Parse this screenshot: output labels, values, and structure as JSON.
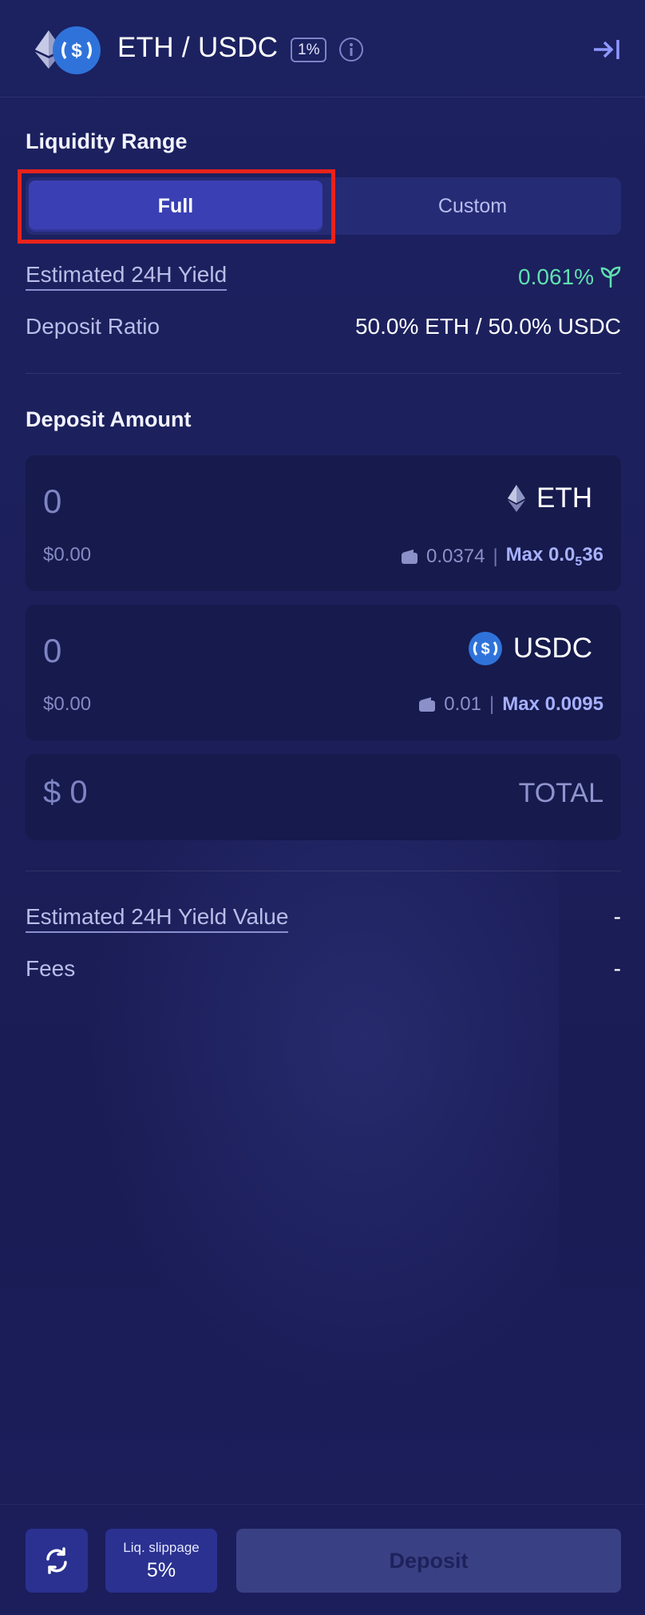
{
  "header": {
    "pair": "ETH / USDC",
    "fee_tier": "1%",
    "icons": [
      "eth-icon",
      "usdc-icon",
      "info-icon",
      "collapse-panel-icon"
    ]
  },
  "liquidity_range": {
    "title": "Liquidity Range",
    "options": [
      "Full",
      "Custom"
    ],
    "selected": "Full"
  },
  "stats": {
    "yield_label": "Estimated 24H Yield",
    "yield_value": "0.061%",
    "ratio_label": "Deposit Ratio",
    "ratio_value": "50.0% ETH / 50.0% USDC"
  },
  "deposit": {
    "title": "Deposit Amount",
    "eth": {
      "amount": "0",
      "symbol": "ETH",
      "usd": "$0.00",
      "balance": "0.0374",
      "max_prefix": "Max 0.0",
      "max_sub": "5",
      "max_suffix": "36"
    },
    "usdc": {
      "amount": "0",
      "symbol": "USDC",
      "usd": "$0.00",
      "balance": "0.01",
      "max": "Max 0.0095"
    },
    "total": {
      "dollar_sign": "$",
      "value": "0",
      "label": "TOTAL"
    }
  },
  "summary": {
    "yield_value_label": "Estimated 24H Yield Value",
    "yield_value": "-",
    "fees_label": "Fees",
    "fees_value": "-"
  },
  "footer": {
    "slippage_label": "Liq. slippage",
    "slippage_value": "5%",
    "deposit_label": "Deposit"
  },
  "colors": {
    "background": "#1c2160",
    "accent": "#3a3fb4",
    "yield_green": "#5fe0b0",
    "highlight_red": "#e8231b",
    "usdc_blue": "#2f73da"
  }
}
